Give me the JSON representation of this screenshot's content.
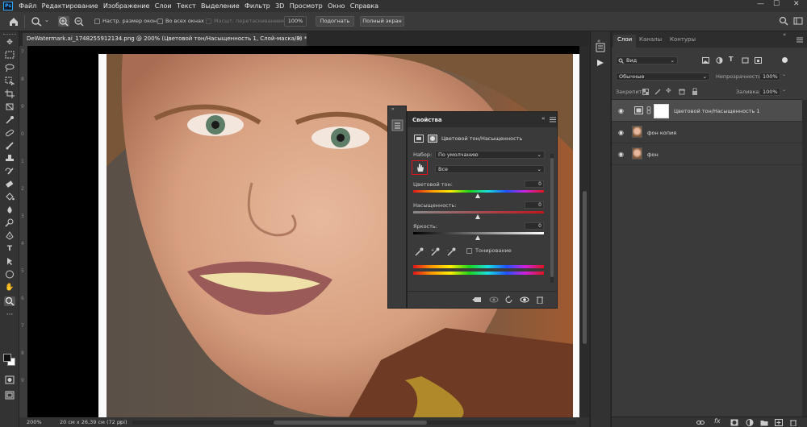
{
  "app": {
    "logo_text": "Ps"
  },
  "menu": [
    "Файл",
    "Редактирование",
    "Изображение",
    "Слои",
    "Текст",
    "Выделение",
    "Фильтр",
    "3D",
    "Просмотр",
    "Окно",
    "Справка"
  ],
  "window_controls": {
    "minimize": "—",
    "maximize": "☐",
    "close": "✕"
  },
  "options": {
    "resize_windows": "Настр. размер окон",
    "all_windows": "Во всех окнах",
    "scrubby_zoom": "Масшт. перетаскиванием",
    "zoom_value": "100%",
    "fit_button": "Подогнать",
    "fullscreen_button": "Полный экран"
  },
  "document": {
    "tab_title": "DeWatermark.ai_1748255912134.png @ 200% (Цветовой тон/Насыщенность 1, Слой-маска/8) *",
    "close": "×",
    "ruler_marks": [
      "7",
      "8",
      "9",
      "0",
      "1",
      "2",
      "3",
      "4",
      "5",
      "6",
      "7",
      "8",
      "9"
    ]
  },
  "status": {
    "zoom": "200%",
    "size": "20 см x 26,39 см (72 ppi)",
    "arrow": "›"
  },
  "layers_panel": {
    "tabs": [
      "Слои",
      "Каналы",
      "Контуры"
    ],
    "filter_label": "Вид",
    "blend_mode": "Обычные",
    "opacity_label": "Непрозрачность:",
    "opacity_value": "100%",
    "lock_label": "Закрепить:",
    "fill_label": "Заливка:",
    "fill_value": "100%",
    "layers": [
      {
        "name": "Цветовой тон/Насыщенность 1"
      },
      {
        "name": "фон копия"
      },
      {
        "name": "фон"
      }
    ],
    "footer_fx": "fx"
  },
  "properties": {
    "title": "Свойства",
    "subtitle": "Цветовой тон/Насыщенность",
    "preset_label": "Набор:",
    "preset_value": "По умолчанию",
    "channel_value": "Все",
    "hue_label": "Цветовой тон:",
    "hue_value": "0",
    "saturation_label": "Насыщенность:",
    "saturation_value": "0",
    "lightness_label": "Яркость:",
    "lightness_value": "0",
    "colorize_label": "Тонирование"
  },
  "colors": {
    "accent": "#31a8ff",
    "highlight": "#e0151b"
  }
}
